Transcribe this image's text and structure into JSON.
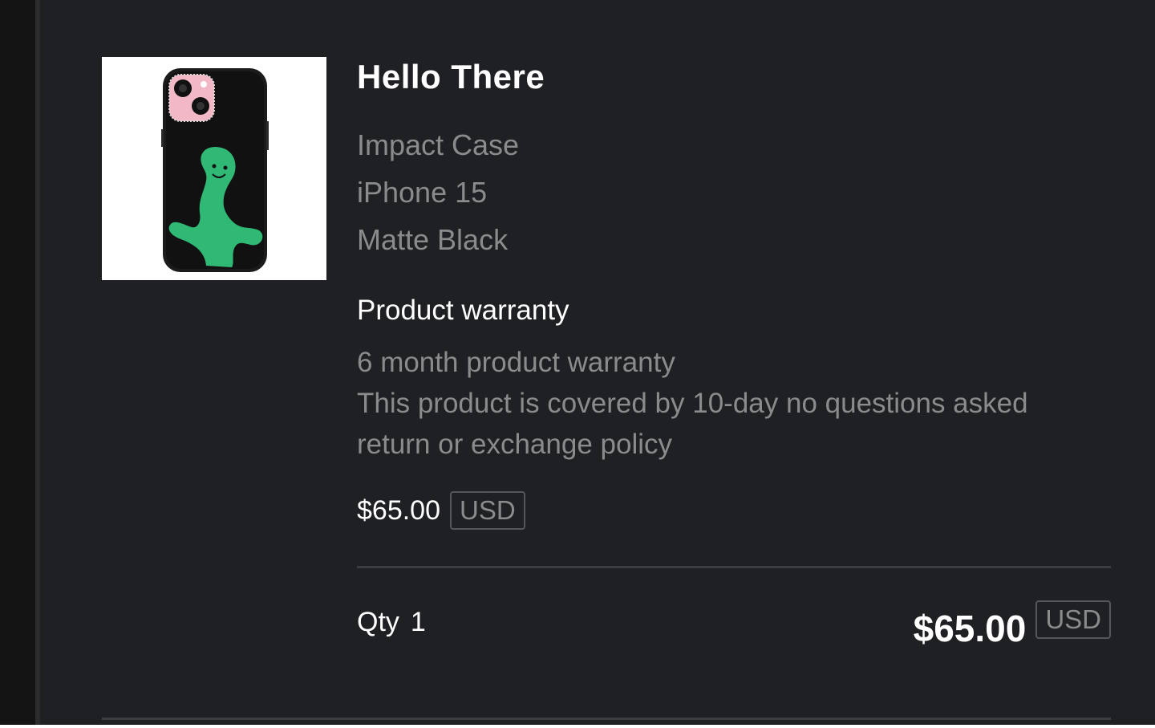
{
  "product": {
    "title": "Hello There",
    "image_icon": "phone-case-image",
    "variants": [
      "Impact Case",
      "iPhone 15",
      "Matte Black"
    ]
  },
  "warranty": {
    "heading": "Product warranty",
    "duration": "6 month product warranty",
    "policy": "This product is covered by 10-day no questions asked return or exchange policy"
  },
  "pricing": {
    "price": "$65.00",
    "currency": "USD",
    "qty_label": "Qty",
    "qty_value": "1",
    "total": "$65.00",
    "total_currency": "USD"
  },
  "colors": {
    "background": "#1f2023",
    "text_primary": "#ffffff",
    "text_secondary": "#8a8b8d",
    "case_color": "#1b1b1b",
    "case_accent": "#f2b8c6",
    "figure_green": "#2fb974"
  }
}
